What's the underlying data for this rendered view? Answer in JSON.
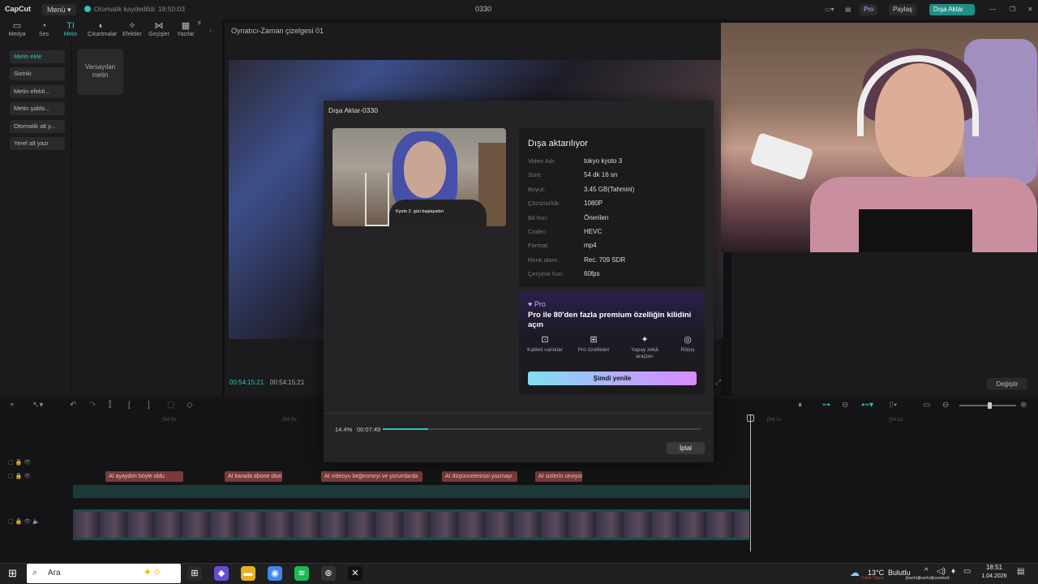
{
  "titlebar": {
    "logo": "CapCut",
    "menu": "Menü ▾",
    "autosave": "Otomatik kaydedildi: 18:50:03",
    "project_name": "0330",
    "pro": "Pro",
    "share": "Paylaş",
    "export": "Dışa Aktar"
  },
  "tooltabs": [
    {
      "icon": "▭",
      "label": "Medya"
    },
    {
      "icon": "◔",
      "label": "Ses"
    },
    {
      "icon": "TI",
      "label": "Metin"
    },
    {
      "icon": "◐",
      "label": "Çıkartmalar"
    },
    {
      "icon": "✧",
      "label": "Efektler"
    },
    {
      "icon": "⋈",
      "label": "Geçişler"
    },
    {
      "icon": "▦",
      "label": "Yazılar"
    },
    {
      "icon": "",
      "label": "F"
    }
  ],
  "sidebar": {
    "items": [
      "Metin ekle",
      "Sizinki",
      "Metin efekti...",
      "Metin şablo...",
      "Otomatik alt y...",
      "Yerel alt yazı"
    ],
    "default_text": "Varsayılan metin"
  },
  "player": {
    "title": "Oynatıcı-Zaman çizelgesi 01",
    "current_time": "00:54:15:21",
    "total_time": "00:54:15:21"
  },
  "right_panel": {
    "change": "Değiştir"
  },
  "timeline": {
    "ruler": [
      "|54:0s",
      "|54:0s",
      "|54:1s",
      "|54:1s"
    ],
    "captions": [
      {
        "text": "AI  ayaydım böyle oldu",
        "color": "#7a3a3a"
      },
      {
        "text": "AI  karada abone olun",
        "color": "#7a3a3a"
      },
      {
        "text": "AI  videoyu beğenmeyi ve yorumlarda",
        "color": "#7a3a3a"
      },
      {
        "text": "AI  düşüncelerinizi yazmayı",
        "color": "#7a3a3a"
      },
      {
        "text": "AI  sizlerin seviyoru",
        "color": "#7a3a3a"
      }
    ]
  },
  "dialog": {
    "title": "Dışa Aktar-0330",
    "thumb_caption": "Kyoto 2. gün başlayadın",
    "heading": "Dışa aktarılıyor",
    "info": [
      {
        "label": "Video Adı:",
        "value": "tokyo kyoto 3"
      },
      {
        "label": "Süre:",
        "value": "54 dk 16 sn"
      },
      {
        "label": "Boyut:",
        "value": "3.45 GB(Tahmini)"
      },
      {
        "label": "Çözünürlük:",
        "value": "1080P"
      },
      {
        "label": "Bit hızı:",
        "value": "Önerilen"
      },
      {
        "label": "Codec:",
        "value": "HEVC"
      },
      {
        "label": "Format:",
        "value": "mp4"
      },
      {
        "label": "Renk alanı:",
        "value": "Rec. 709 SDR"
      },
      {
        "label": "Çerçeve hızı:",
        "value": "60fps"
      }
    ],
    "pro": {
      "badge": "♥ Pro",
      "heading": "Pro ile 80'den fazla premium özelliğin kilidini açın",
      "features": [
        {
          "icon": "⊡",
          "label": "Kaliteli varlıklar"
        },
        {
          "icon": "⊞",
          "label": "Pro özellikleri"
        },
        {
          "icon": "✦",
          "label": "Yapay zekâ araçları"
        },
        {
          "icon": "◎",
          "label": "Rötuş"
        }
      ],
      "renew": "Şimdi yenile"
    },
    "progress": {
      "percent": "14.4%",
      "elapsed": "00:07:49",
      "fraction": 0.144
    },
    "cancel": "İptal"
  },
  "taskbar": {
    "search_placeholder": "Ara",
    "apps": [
      {
        "icon": "⊞",
        "color": "#2b2b2b"
      },
      {
        "icon": "◆",
        "color": "#6a4bd6"
      },
      {
        "icon": "▬",
        "color": "#e8b21f"
      },
      {
        "icon": "◉",
        "color": "#4285f4"
      },
      {
        "icon": "≋",
        "color": "#1db954"
      },
      {
        "icon": "⊛",
        "color": "#333333"
      },
      {
        "icon": "✕",
        "color": "#111111"
      }
    ],
    "weather_temp": "13°C",
    "weather_desc": "Bulutlu",
    "tray_sub": "Canlı Yayın",
    "tray_sub2": "jkashdjkashdjkasdasd",
    "time": "18:51",
    "date": "1.04.2026"
  }
}
